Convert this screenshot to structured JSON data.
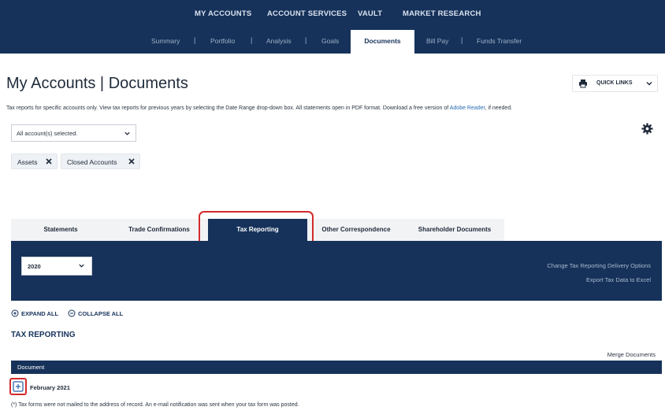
{
  "colors": {
    "navy": "#16325a",
    "highlight": "#d22b2b",
    "link": "#2a6bb3"
  },
  "top_nav": {
    "items": [
      "MY ACCOUNTS",
      "ACCOUNT SERVICES",
      "VAULT",
      "MARKET RESEARCH"
    ]
  },
  "sub_nav": {
    "items": [
      "Summary",
      "Portfolio",
      "Analysis",
      "Goals",
      "Bill Pay",
      "Funds Transfer"
    ],
    "active": "Documents",
    "separator": "|"
  },
  "page": {
    "title": "My Accounts | Documents",
    "quick_links": "QUICK LINKS",
    "intro_text": "Tax reports for specific accounts only. View tax reports for previous years by selecting the Date Range drop-down box. All statements open in PDF format. Download a free version of ",
    "intro_link": "Adobe Reader",
    "intro_suffix": ", if needed.",
    "account_select": "All account(s) selected."
  },
  "filters": [
    {
      "label": "Assets"
    },
    {
      "label": "Closed Accounts"
    }
  ],
  "icons": {
    "print": "print-icon",
    "chevron": "chevron-down-icon",
    "gear": "gear-icon",
    "close": "close-icon",
    "expand": "plus-circle-icon",
    "collapse": "minus-circle-icon",
    "row_expand": "plus-square-icon"
  },
  "doc_tabs": {
    "items": [
      "Statements",
      "Trade Confirmations",
      "Tax Reporting",
      "Other Correspondence",
      "Shareholder Documents"
    ],
    "active": "Tax Reporting"
  },
  "panel": {
    "year": "2020",
    "links": [
      "Change Tax Reporting Delivery Options",
      "Export Tax Data to Excel"
    ]
  },
  "controls": {
    "expand_all": "EXPAND ALL",
    "collapse_all": "COLLAPSE ALL"
  },
  "section": {
    "title": "TAX REPORTING",
    "merge": "Merge Documents"
  },
  "table": {
    "header": "Document",
    "rows": [
      {
        "label": "February 2021"
      }
    ],
    "footnote": "(*) Tax forms were not mailed to the address of record. An e-mail notification was sent when your tax form was posted."
  }
}
